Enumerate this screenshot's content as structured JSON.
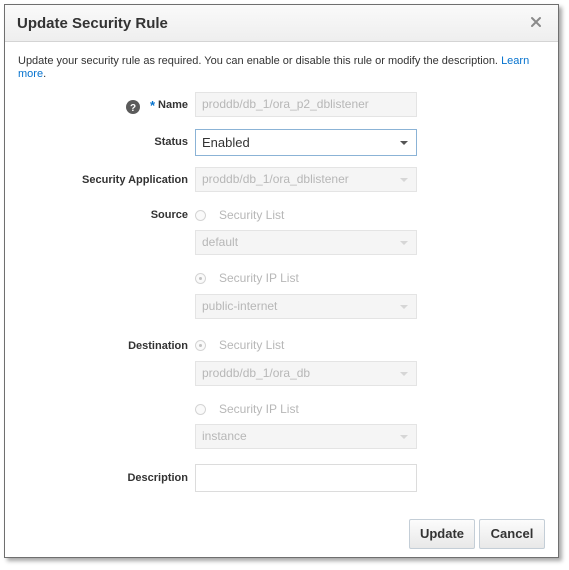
{
  "dialog": {
    "title": "Update Security Rule",
    "intro_text": "Update your security rule as required. You can enable or disable this rule or modify the description.",
    "learn_more": "Learn more",
    "learn_more_punct": "."
  },
  "form": {
    "name": {
      "label": "Name",
      "value": "proddb/db_1/ora_p2_dblistener",
      "required_mark": "*"
    },
    "status": {
      "label": "Status",
      "value": "Enabled"
    },
    "security_application": {
      "label": "Security Application",
      "value": "proddb/db_1/ora_dblistener"
    },
    "source": {
      "label": "Source",
      "option1_label": "Security List",
      "option1_value": "default",
      "option2_label": "Security IP List",
      "option2_value": "public-internet",
      "selected": "Security IP List"
    },
    "destination": {
      "label": "Destination",
      "option1_label": "Security List",
      "option1_value": "proddb/db_1/ora_db",
      "option2_label": "Security IP List",
      "option2_value": "instance",
      "selected": "Security List"
    },
    "description": {
      "label": "Description",
      "value": ""
    }
  },
  "buttons": {
    "update": "Update",
    "cancel": "Cancel"
  },
  "colors": {
    "accent": "#0572ce",
    "text": "#333333",
    "disabled_text": "#b7b7b7"
  }
}
